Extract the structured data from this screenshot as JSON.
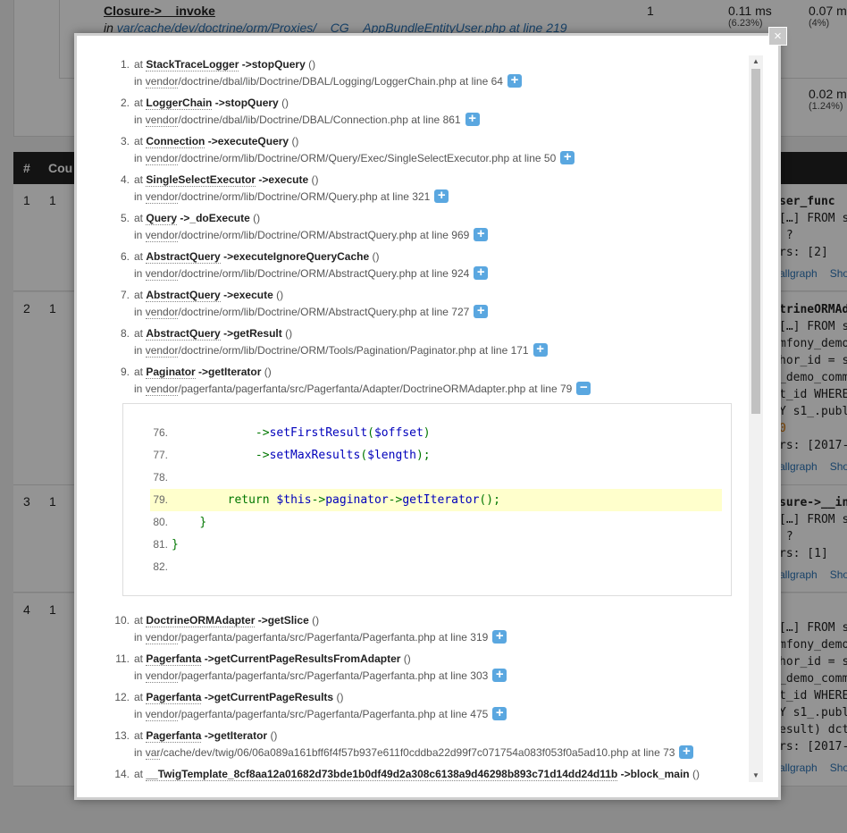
{
  "background": {
    "top_row": {
      "title": "Closure->__invoke",
      "in_word": "in",
      "file_prefix": "var/cache/dev/doctrine/orm/Proxies/",
      "file_mid": "__CG__",
      "file_suffix": "AppBundleEntityUser.php at line 219",
      "count": "1",
      "time1": "0.11 ms",
      "pct1": "(6.23%)",
      "time2": "0.07 m",
      "pct2": "(4%)",
      "time3": "0.02 m",
      "pct3": "(1.24%)"
    },
    "table_header": {
      "col_num": "#",
      "col_count": "Cou"
    },
    "rows": [
      {
        "num": "1",
        "count": "1",
        "sql": [
          "ser_func",
          "[…] FROM s",
          " ?",
          "rs: [2]"
        ],
        "links": [
          "allgraph",
          "Show"
        ]
      },
      {
        "num": "2",
        "count": "1",
        "sql": [
          "trineORMAda",
          "[…] FROM s",
          "mfony_demo",
          "hor_id = s",
          "_demo_comm",
          "t_id WHERE",
          "Y s1_.publ",
          "0",
          "rs: [2017-"
        ],
        "links": [
          "allgraph",
          "Show"
        ]
      },
      {
        "num": "3",
        "count": "1",
        "sql": [
          "sure->__inv",
          "[…] FROM s",
          " ?",
          "rs: [1]"
        ],
        "links": [
          "allgraph",
          "Show"
        ]
      },
      {
        "num": "4",
        "count": "1",
        "sql": [
          "[…] FROM s",
          "mfony_demo",
          "hor_id = s",
          "_demo_comm",
          "t_id WHERE",
          "Y s1_.publ",
          "esult) dct",
          "rs: [2017-"
        ],
        "links": [
          "allgraph",
          "Show"
        ]
      }
    ]
  },
  "modal": {
    "close_label": "×",
    "at_word": "at",
    "in_word": "in",
    "vendor_word": "vendor",
    "var_word": "var",
    "trace": [
      {
        "num": "1.",
        "cls": "StackTraceLogger",
        "fn": "->stopQuery",
        "args": "()",
        "path": "/doctrine/dbal/lib/Doctrine/DBAL/Logging/LoggerChain.php at line 64",
        "root": "vendor",
        "toggle": "+"
      },
      {
        "num": "2.",
        "cls": "LoggerChain",
        "fn": "->stopQuery",
        "args": "()",
        "path": "/doctrine/dbal/lib/Doctrine/DBAL/Connection.php at line 861",
        "root": "vendor",
        "toggle": "+"
      },
      {
        "num": "3.",
        "cls": "Connection",
        "fn": "->executeQuery",
        "args": "()",
        "path": "/doctrine/orm/lib/Doctrine/ORM/Query/Exec/SingleSelectExecutor.php at line 50",
        "root": "vendor",
        "toggle": "+"
      },
      {
        "num": "4.",
        "cls": "SingleSelectExecutor",
        "fn": "->execute",
        "args": "()",
        "path": "/doctrine/orm/lib/Doctrine/ORM/Query.php at line 321",
        "root": "vendor",
        "toggle": "+"
      },
      {
        "num": "5.",
        "cls": "Query",
        "fn": "->_doExecute",
        "args": "()",
        "path": "/doctrine/orm/lib/Doctrine/ORM/AbstractQuery.php at line 969",
        "root": "vendor",
        "toggle": "+"
      },
      {
        "num": "6.",
        "cls": "AbstractQuery",
        "fn": "->executeIgnoreQueryCache",
        "args": "()",
        "path": "/doctrine/orm/lib/Doctrine/ORM/AbstractQuery.php at line 924",
        "root": "vendor",
        "toggle": "+"
      },
      {
        "num": "7.",
        "cls": "AbstractQuery",
        "fn": "->execute",
        "args": "()",
        "path": "/doctrine/orm/lib/Doctrine/ORM/AbstractQuery.php at line 727",
        "root": "vendor",
        "toggle": "+"
      },
      {
        "num": "8.",
        "cls": "AbstractQuery",
        "fn": "->getResult",
        "args": "()",
        "path": "/doctrine/orm/lib/Doctrine/ORM/Tools/Pagination/Paginator.php at line 171",
        "root": "vendor",
        "toggle": "+"
      },
      {
        "num": "9.",
        "cls": "Paginator",
        "fn": "->getIterator",
        "args": "()",
        "path": "/pagerfanta/pagerfanta/src/Pagerfanta/Adapter/DoctrineORMAdapter.php at line 79",
        "root": "vendor",
        "toggle": "−"
      },
      {
        "num": "10.",
        "cls": "DoctrineORMAdapter",
        "fn": "->getSlice",
        "args": "()",
        "path": "/pagerfanta/pagerfanta/src/Pagerfanta/Pagerfanta.php at line 319",
        "root": "vendor",
        "toggle": "+"
      },
      {
        "num": "11.",
        "cls": "Pagerfanta",
        "fn": "->getCurrentPageResultsFromAdapter",
        "args": "()",
        "path": "/pagerfanta/pagerfanta/src/Pagerfanta/Pagerfanta.php at line 303",
        "root": "vendor",
        "toggle": "+"
      },
      {
        "num": "12.",
        "cls": "Pagerfanta",
        "fn": "->getCurrentPageResults",
        "args": "()",
        "path": "/pagerfanta/pagerfanta/src/Pagerfanta/Pagerfanta.php at line 475",
        "root": "vendor",
        "toggle": "+"
      },
      {
        "num": "13.",
        "cls": "Pagerfanta",
        "fn": "->getIterator",
        "args": "()",
        "path": "/cache/dev/twig/06/06a089a161bff6f4f57b937e611f0cddba22d99f7c071754a083f053f0a5ad10.php at line 73",
        "root": "var",
        "toggle": "+"
      },
      {
        "num": "14.",
        "cls": "__TwigTemplate_8cf8aa12a01682d73bde1b0df49d2a308c6138a9d46298b893c71d14dd24d11b",
        "fn": "->block_main",
        "args": "()",
        "path": "",
        "root": "",
        "toggle": ""
      }
    ],
    "code": [
      {
        "ln": "76.",
        "text": "            ->setFirstResult($offset)"
      },
      {
        "ln": "77.",
        "text": "            ->setMaxResults($length);"
      },
      {
        "ln": "78.",
        "text": ""
      },
      {
        "ln": "79.",
        "text": "        return $this->paginator->getIterator();"
      },
      {
        "ln": "80.",
        "text": "    }"
      },
      {
        "ln": "81.",
        "text": "}"
      },
      {
        "ln": "82.",
        "text": ""
      }
    ],
    "highlighted_line": "79."
  }
}
